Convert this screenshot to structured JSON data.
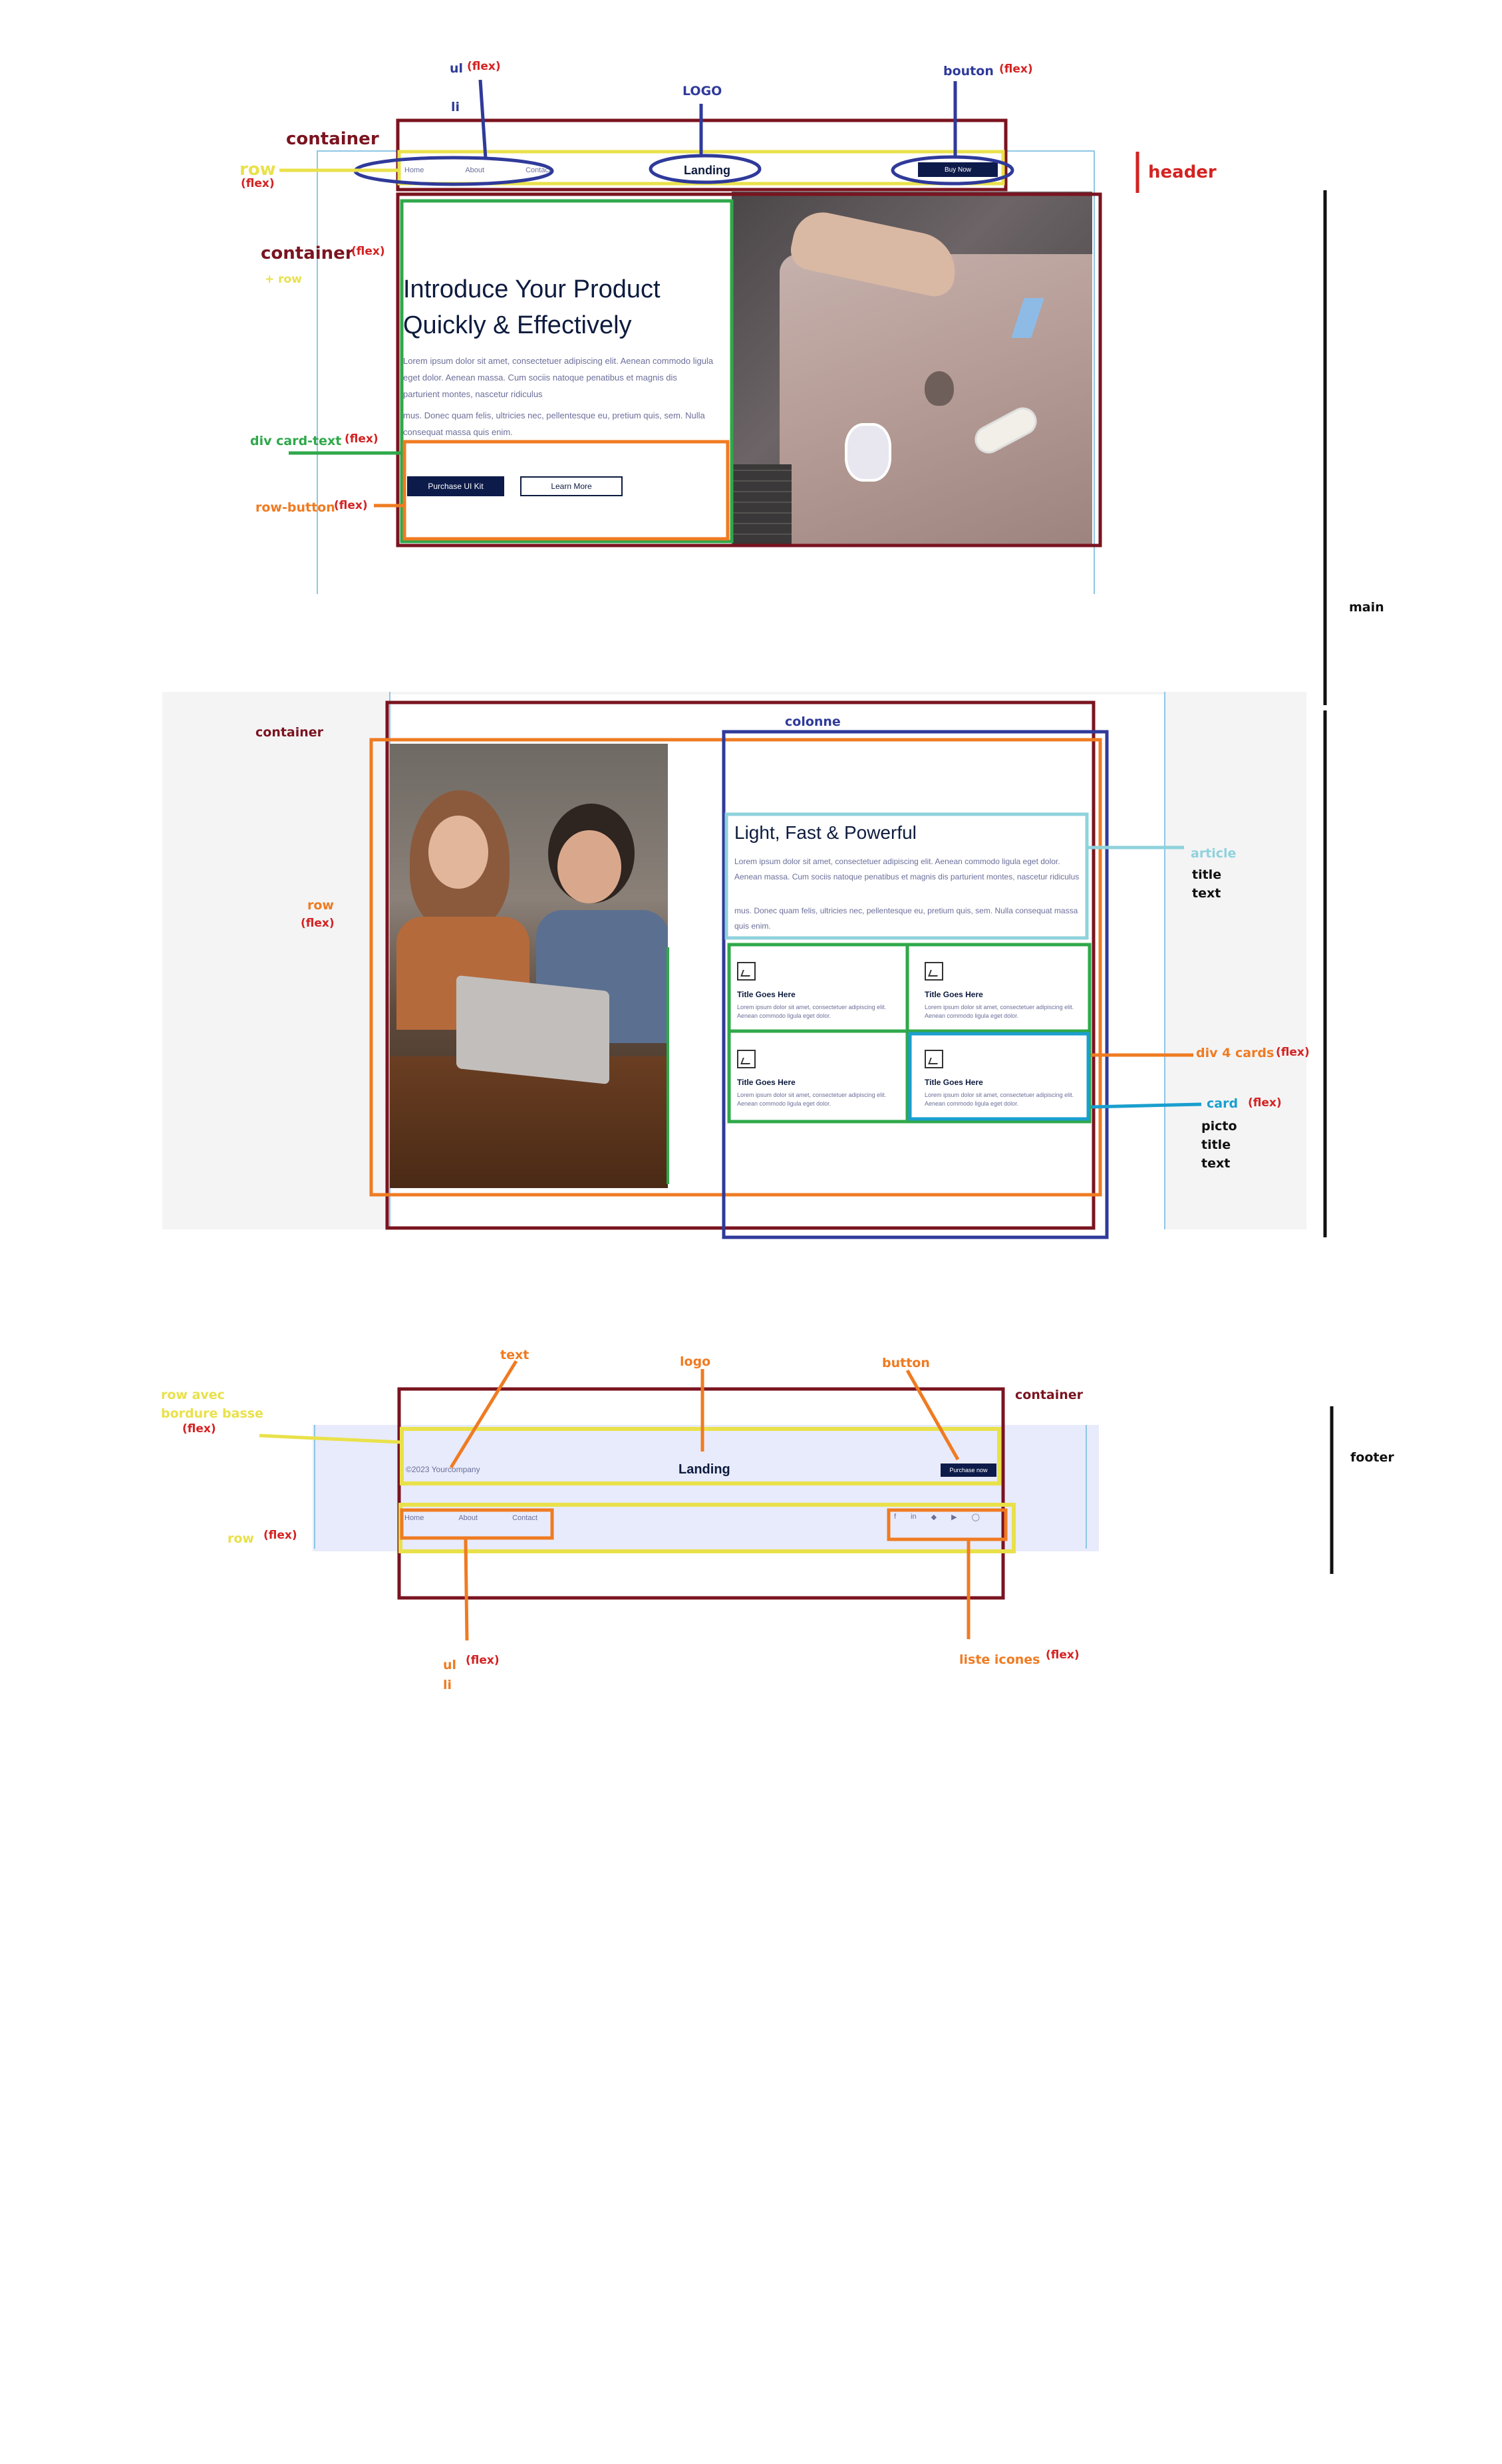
{
  "header_mock": {
    "nav": [
      "Home",
      "About",
      "Contact"
    ],
    "logo": "Landing",
    "button": "Buy Now"
  },
  "hero_mock": {
    "title_line1": "Introduce Your Product",
    "title_line2": "Quickly & Effectively",
    "para1": "Lorem ipsum dolor sit amet, consectetuer adipiscing elit. Aenean commodo ligula eget dolor. Aenean massa. Cum sociis natoque penatibus et magnis dis parturient montes, nascetur ridiculus",
    "para2": "mus. Donec quam felis, ultricies nec, pellentesque eu, pretium quis, sem. Nulla consequat massa quis enim.",
    "primary_button": "Purchase UI Kit",
    "secondary_button": "Learn More"
  },
  "features_mock": {
    "title": "Light, Fast & Powerful",
    "para1": "Lorem ipsum dolor sit amet, consectetuer adipiscing elit. Aenean commodo ligula eget dolor. Aenean massa. Cum sociis natoque penatibus et magnis dis parturient montes, nascetur ridiculus",
    "para2": "mus. Donec quam felis, ultricies nec, pellentesque eu, pretium quis, sem. Nulla consequat massa quis enim.",
    "cards": [
      {
        "title": "Title Goes Here",
        "text": "Lorem ipsum dolor sit amet, consectetuer adipiscing elit. Aenean commodo ligula eget dolor."
      },
      {
        "title": "Title Goes Here",
        "text": "Lorem ipsum dolor sit amet, consectetuer adipiscing elit. Aenean commodo ligula eget dolor."
      },
      {
        "title": "Title Goes Here",
        "text": "Lorem ipsum dolor sit amet, consectetuer adipiscing elit. Aenean commodo ligula eget dolor."
      },
      {
        "title": "Title Goes Here",
        "text": "Lorem ipsum dolor sit amet, consectetuer adipiscing elit. Aenean commodo ligula eget dolor."
      }
    ]
  },
  "footer_mock": {
    "copyright": "©2023 Yourcompany",
    "logo": "Landing",
    "button": "Purchase now",
    "nav": [
      "Home",
      "About",
      "Contact"
    ],
    "social_icons": [
      "facebook-icon",
      "linkedin-icon",
      "twitter-icon",
      "youtube-icon",
      "instagram-icon"
    ]
  },
  "annotations": {
    "header": {
      "ul": "ul",
      "ul_flex": "(flex)",
      "li": "li",
      "logo": "LOGO",
      "bouton": "bouton",
      "bouton_flex": "(flex)",
      "container": "container",
      "row": "row",
      "row_flex": "(flex)",
      "header": "header",
      "container2": "container",
      "container2_flex": "(flex)",
      "plus_row": "+ row",
      "card_text": "div card-text",
      "card_text_flex": "(flex)",
      "row_button": "row-button",
      "row_button_flex": "(flex)"
    },
    "main": "main",
    "features": {
      "container": "container",
      "colonne": "colonne",
      "row": "row",
      "row_flex": "(flex)",
      "article": "article",
      "article_title": "title",
      "article_text": "text",
      "div4": "div 4 cards",
      "div4_flex": "(flex)",
      "card": "card",
      "card_flex": "(flex)",
      "card_picto": "picto",
      "card_title": "title",
      "card_text": "text"
    },
    "footer": {
      "text": "text",
      "logo": "logo",
      "button": "button",
      "row_bordure_1": "row avec",
      "row_bordure_2": "bordure basse",
      "row_bordure_flex": "(flex)",
      "container": "container",
      "footer": "footer",
      "row": "row",
      "row_flex": "(flex)",
      "ul": "ul",
      "ul_flex": "(flex)",
      "li": "li",
      "liste_icones": "liste icones",
      "liste_icones_flex": "(flex)"
    }
  },
  "colors": {
    "maroon": "#7a1420",
    "navy": "#2f3a9a",
    "orange": "#ef7b22",
    "yellow": "#e9e14a",
    "green": "#2fa84a",
    "cyan": "#8fd2dc",
    "teal": "#1a9fce",
    "red": "#d42222",
    "dark_button": "#0d1b4a"
  }
}
